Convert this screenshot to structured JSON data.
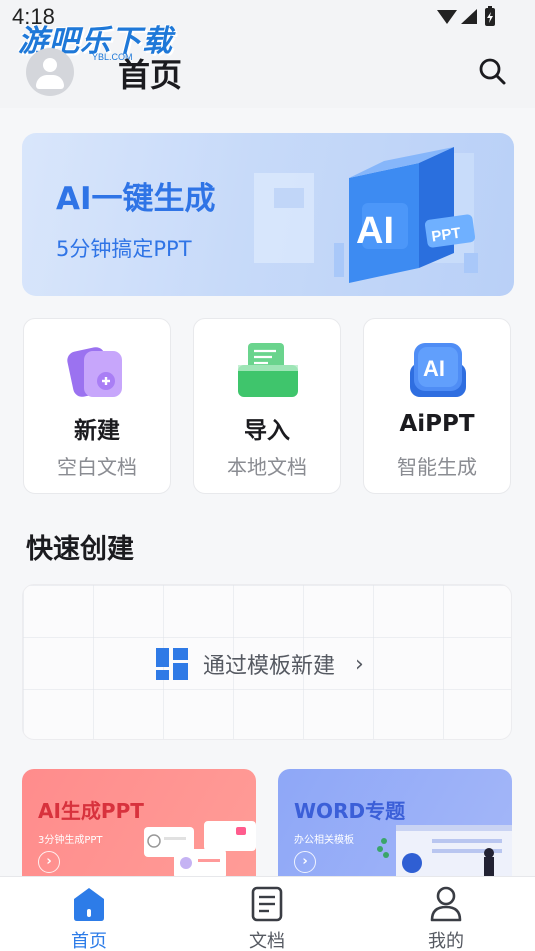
{
  "status_bar": {
    "time": "4:18"
  },
  "watermark": {
    "text": "游吧乐下载",
    "sub": "YBL.COM"
  },
  "header": {
    "title": "首页"
  },
  "banner": {
    "title": "AI一键生成",
    "subtitle": "5分钟搞定PPT",
    "art_label": "AI",
    "art_tag": "PPT"
  },
  "actions": [
    {
      "title": "新建",
      "subtitle": "空白文档",
      "icon": "new-doc-icon"
    },
    {
      "title": "导入",
      "subtitle": "本地文档",
      "icon": "import-folder-icon"
    },
    {
      "title": "AiPPT",
      "subtitle": "智能生成",
      "icon": "ai-icon",
      "icon_text": "AI"
    }
  ],
  "quick_create": {
    "section_title": "快速创建",
    "template_label": "通过模板新建",
    "chevron": "›"
  },
  "promos": [
    {
      "title": "AI生成PPT",
      "subtitle": "3分钟生成PPT",
      "go": "›"
    },
    {
      "title": "WORD专题",
      "subtitle": "办公相关模板",
      "go": "›"
    }
  ],
  "bottom_nav": [
    {
      "label": "首页",
      "active": true,
      "icon": "home-icon"
    },
    {
      "label": "文档",
      "active": false,
      "icon": "document-icon"
    },
    {
      "label": "我的",
      "active": false,
      "icon": "profile-icon"
    }
  ],
  "colors": {
    "accent": "#2d7ce8",
    "banner_text": "#2f74e6",
    "promo_red": "#ff8c8c",
    "promo_blue": "#8ea7f7"
  }
}
